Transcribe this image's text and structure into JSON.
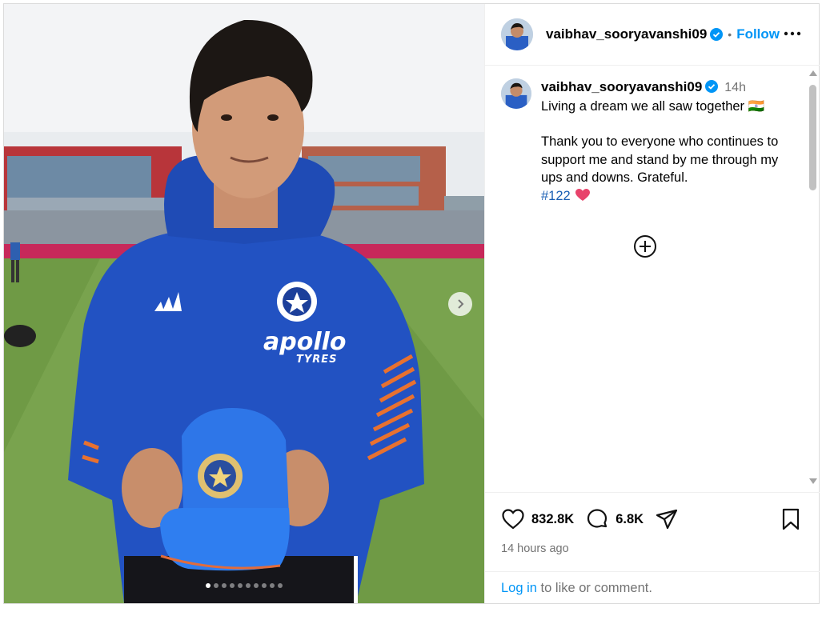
{
  "post": {
    "username": "vaibhav_sooryavanshi09",
    "follow_label": "Follow",
    "separator": "•",
    "caption_username": "vaibhav_sooryavanshi09",
    "caption_time": "14h",
    "caption_line1": "Living a dream we all saw together 🇮🇳",
    "caption_line2": "Thank you to everyone who continues to support me and stand by me through my ups and downs. Grateful.",
    "hashtag": "#122",
    "likes": "832.8K",
    "comments": "6.8K",
    "time_ago": "14 hours ago",
    "login_link": "Log in",
    "login_rest": " to like or comment."
  },
  "media": {
    "slides": 10,
    "active_slide": 1,
    "jersey_sponsor": "apollo",
    "jersey_sponsor_sub": "TYRES"
  },
  "colors": {
    "accent": "#0095f6",
    "verified": "#0095f6",
    "jersey": "#1f4fbf",
    "grass": "#6f9a45"
  }
}
